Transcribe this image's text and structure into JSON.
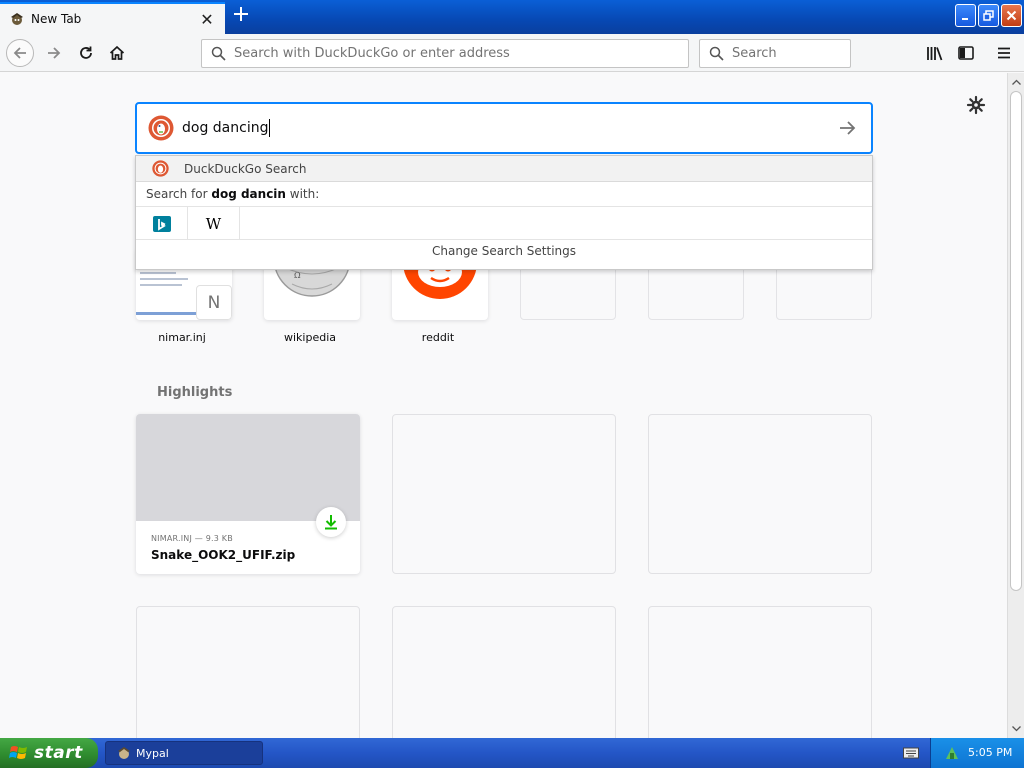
{
  "browser": {
    "tab_title": "New Tab",
    "url_placeholder": "Search with DuckDuckGo or enter address",
    "search_placeholder": "Search"
  },
  "search": {
    "query": "dog dancing",
    "engine_label": "DuckDuckGo Search",
    "search_for_prefix": "Search for ",
    "search_for_term": "dog dancin",
    "search_for_suffix": " with:",
    "settings_label": "Change Search Settings",
    "wiki_glyph": "W"
  },
  "top_sites": [
    {
      "label": "nimar.inj",
      "letter": "N"
    },
    {
      "label": "wikipedia"
    },
    {
      "label": "reddit"
    }
  ],
  "highlights": {
    "title": "Highlights",
    "card": {
      "meta": "NIMAR.INJ — 9.3 KB",
      "name": "Snake_OOK2_UFIF.zip"
    }
  },
  "taskbar": {
    "start_label": "start",
    "app_label": "Mypal",
    "clock": "5:05 PM"
  },
  "colors": {
    "accent": "#0a84ff",
    "download_green": "#12bc00",
    "reddit": "#ff4500"
  }
}
